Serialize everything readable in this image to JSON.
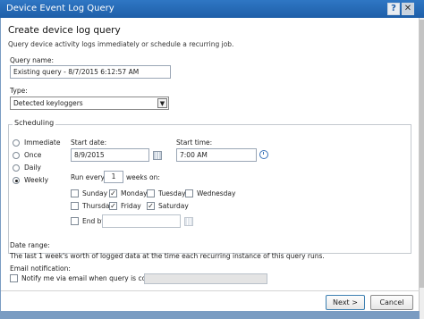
{
  "window": {
    "title": "Device Event Log Query",
    "help_label": "?",
    "close_label": "✕"
  },
  "header": {
    "heading": "Create device log query",
    "subtext": "Query device activity logs immediately or schedule a recurring job."
  },
  "query_name": {
    "label": "Query name:",
    "value": "Existing query - 8/7/2015 6:12:57 AM"
  },
  "type": {
    "label": "Type:",
    "selected": "Detected keyloggers"
  },
  "scheduling": {
    "legend": "Scheduling",
    "frequency_options": [
      {
        "label": "Immediate",
        "selected": false
      },
      {
        "label": "Once",
        "selected": false
      },
      {
        "label": "Daily",
        "selected": false
      },
      {
        "label": "Weekly",
        "selected": true
      }
    ],
    "start_date": {
      "label": "Start date:",
      "value": "8/9/2015"
    },
    "start_time": {
      "label": "Start time:",
      "value": "7:00 AM"
    },
    "run_every": {
      "prefix": "Run every",
      "value": "1",
      "suffix": "weeks on:"
    },
    "days": [
      {
        "label": "Sunday",
        "checked": false
      },
      {
        "label": "Monday",
        "checked": true
      },
      {
        "label": "Tuesday",
        "checked": false
      },
      {
        "label": "Wednesday",
        "checked": false
      },
      {
        "label": "Thursday",
        "checked": false
      },
      {
        "label": "Friday",
        "checked": true
      },
      {
        "label": "Saturday",
        "checked": true
      }
    ],
    "end_by": {
      "label": "End by:",
      "checked": false,
      "value": ""
    }
  },
  "date_range": {
    "label": "Date range:",
    "text": "The last 1 week's worth of logged data at the time each recurring instance of this query runs."
  },
  "email": {
    "label": "Email notification:",
    "checkbox_label": "Notify me via email when query is complete:",
    "checked": false,
    "value": ""
  },
  "buttons": {
    "next": "Next >",
    "cancel": "Cancel"
  },
  "icons": {
    "select_arrow": "▼",
    "check": "✓"
  }
}
